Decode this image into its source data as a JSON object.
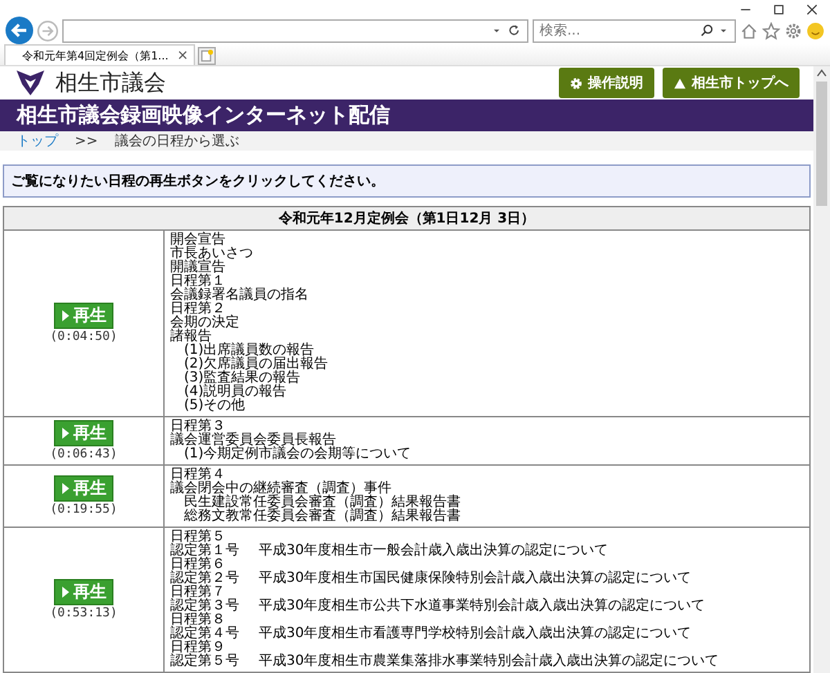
{
  "browser": {
    "search": {
      "placeholder": "検索..."
    },
    "tab": {
      "title": "令和元年第4回定例会（第1...",
      "close": "×"
    }
  },
  "header": {
    "site_name": "相生市議会",
    "buttons": [
      {
        "label": "操作説明",
        "kind": "help"
      },
      {
        "label": "相生市トップへ",
        "kind": "home"
      }
    ]
  },
  "banner": {
    "title": "相生市議会録画映像インターネット配信"
  },
  "breadcrumb": {
    "link": "トップ",
    "separator": ">>",
    "current": "議会の日程から選ぶ"
  },
  "notice": "ご覧になりたい日程の再生ボタンをクリックしてください。",
  "table": {
    "title": "令和元年12月定例会（第1日12月 3日）",
    "rows": [
      {
        "play": "再生",
        "time": "(0:04:50)",
        "items": [
          {
            "text": "開会宣告"
          },
          {
            "text": "市長あいさつ"
          },
          {
            "text": "開議宣告"
          },
          {
            "text": "日程第１"
          },
          {
            "text": "会議録署名議員の指名"
          },
          {
            "text": "日程第２"
          },
          {
            "text": "会期の決定"
          },
          {
            "text": "諸報告",
            "children": [
              {
                "text": "(1)出席議員数の報告"
              },
              {
                "text": "(2)欠席議員の届出報告"
              },
              {
                "text": "(3)監査結果の報告"
              },
              {
                "text": "(4)説明員の報告"
              },
              {
                "text": "(5)その他"
              }
            ]
          }
        ]
      },
      {
        "play": "再生",
        "time": "(0:06:43)",
        "items": [
          {
            "text": "日程第３"
          },
          {
            "text": "議会運営委員会委員長報告",
            "children": [
              {
                "text": "(1)今期定例市議会の会期等について"
              }
            ]
          }
        ]
      },
      {
        "play": "再生",
        "time": "(0:19:55)",
        "items": [
          {
            "text": "日程第４"
          },
          {
            "text": "議会閉会中の継続審査（調査）事件",
            "children": [
              {
                "text": "民生建設常任委員会審査（調査）結果報告書"
              },
              {
                "text": "総務文教常任委員会審査（調査）結果報告書"
              }
            ]
          }
        ]
      },
      {
        "play": "再生",
        "time": "(0:53:13)",
        "items": [
          {
            "text": "日程第５"
          },
          {
            "text": "認定第１号",
            "title": "平成30年度相生市一般会計歳入歳出決算の認定について"
          },
          {
            "text": "日程第６"
          },
          {
            "text": "認定第２号",
            "title": "平成30年度相生市国民健康保険特別会計歳入歳出決算の認定について"
          },
          {
            "text": "日程第７"
          },
          {
            "text": "認定第３号",
            "title": "平成30年度相生市公共下水道事業特別会計歳入歳出決算の認定について"
          },
          {
            "text": "日程第８"
          },
          {
            "text": "認定第４号",
            "title": "平成30年度相生市看護専門学校特別会計歳入歳出決算の認定について"
          },
          {
            "text": "日程第９"
          },
          {
            "text": "認定第５号",
            "title": "平成30年度相生市農業集落排水事業特別会計歳入歳出決算の認定について"
          }
        ]
      }
    ]
  }
}
